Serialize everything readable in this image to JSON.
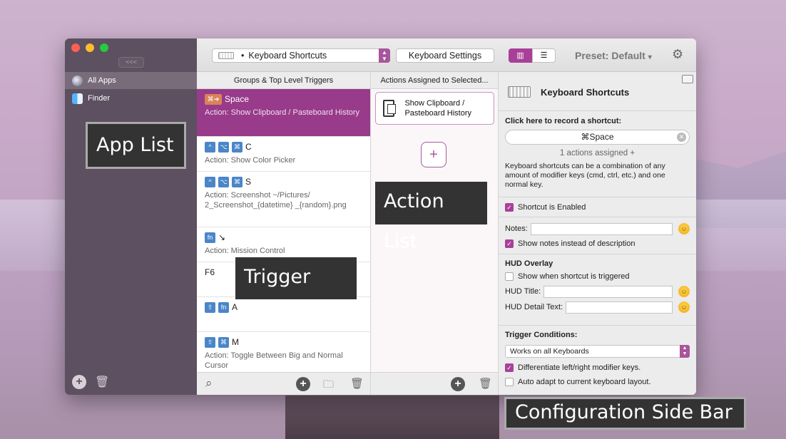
{
  "sidebar": {
    "collapse_label": "<<<",
    "apps": [
      {
        "label": "All Apps",
        "icon": "globe-icon"
      },
      {
        "label": "Finder",
        "icon": "finder-icon"
      }
    ],
    "add_icon": "plus-icon",
    "trash_icon": "trash-icon"
  },
  "toolbar": {
    "dropdown_bullet": "•",
    "dropdown_value": "Keyboard Shortcuts",
    "settings_button": "Keyboard Settings",
    "preset": "Preset: Default",
    "preset_caret": "▾",
    "gear_icon": "⚙"
  },
  "columns": {
    "triggers_header": "Groups & Top Level Triggers",
    "actions_header": "Actions Assigned to Selected..."
  },
  "triggers": [
    {
      "keys": [
        "⌘➔"
      ],
      "key_text": "Space",
      "action": "Action: Show Clipboard / Pasteboard History"
    },
    {
      "keys": [
        "^",
        "⌥",
        "⌘"
      ],
      "key_text": "C",
      "action": "Action: Show Color Picker"
    },
    {
      "keys": [
        "^",
        "⌥",
        "⌘"
      ],
      "key_text": "S",
      "action": "Action: Screenshot ~/Pictures/ 2_Screenshot_{datetime} _{random}.png"
    },
    {
      "keys": [
        "fn"
      ],
      "key_text": "↘",
      "action": "Action: Mission Control"
    },
    {
      "keys": [],
      "key_text": "F6",
      "action": ""
    },
    {
      "keys": [
        "⇧",
        "fn"
      ],
      "key_text": "A",
      "action": ""
    },
    {
      "keys": [
        "⇧",
        "⌘"
      ],
      "key_text": "M",
      "action": "Action: Toggle Between Big and Normal Cursor"
    }
  ],
  "actions": [
    {
      "label": "Show Clipboard / Pasteboard History",
      "icon": "clipboard-icon"
    }
  ],
  "add_action_label": "+",
  "config": {
    "title": "Keyboard Shortcuts",
    "record_label": "Click here to record a shortcut:",
    "shortcut_value": "⌘Space",
    "assigned_text": "1 actions assigned +",
    "description": "Keyboard shortcuts can be a combination of any amount of modifier keys (cmd, ctrl, etc.) and one normal key.",
    "enabled_label": "Shortcut is Enabled",
    "enabled": true,
    "notes_label": "Notes:",
    "show_notes_label": "Show notes instead of description",
    "show_notes": true,
    "hud_header": "HUD Overlay",
    "hud_show_label": "Show when shortcut is triggered",
    "hud_show": false,
    "hud_title_label": "HUD Title:",
    "hud_detail_label": "HUD Detail Text:",
    "conditions_header": "Trigger Conditions:",
    "keyboards_value": "Works on all Keyboards",
    "diff_label": "Differentiate left/right modifier keys.",
    "diff": true,
    "auto_label": "Auto adapt to current keyboard layout.",
    "auto": false
  },
  "overlays": {
    "app_list": "App List",
    "action_list": "Action List",
    "trigger_list": "Trigger List",
    "config_bar": "Configuration Side Bar"
  },
  "colors": {
    "accent": "#a8409a",
    "selected_row": "#983b8a",
    "sidebar_bg": "#5d5060"
  }
}
